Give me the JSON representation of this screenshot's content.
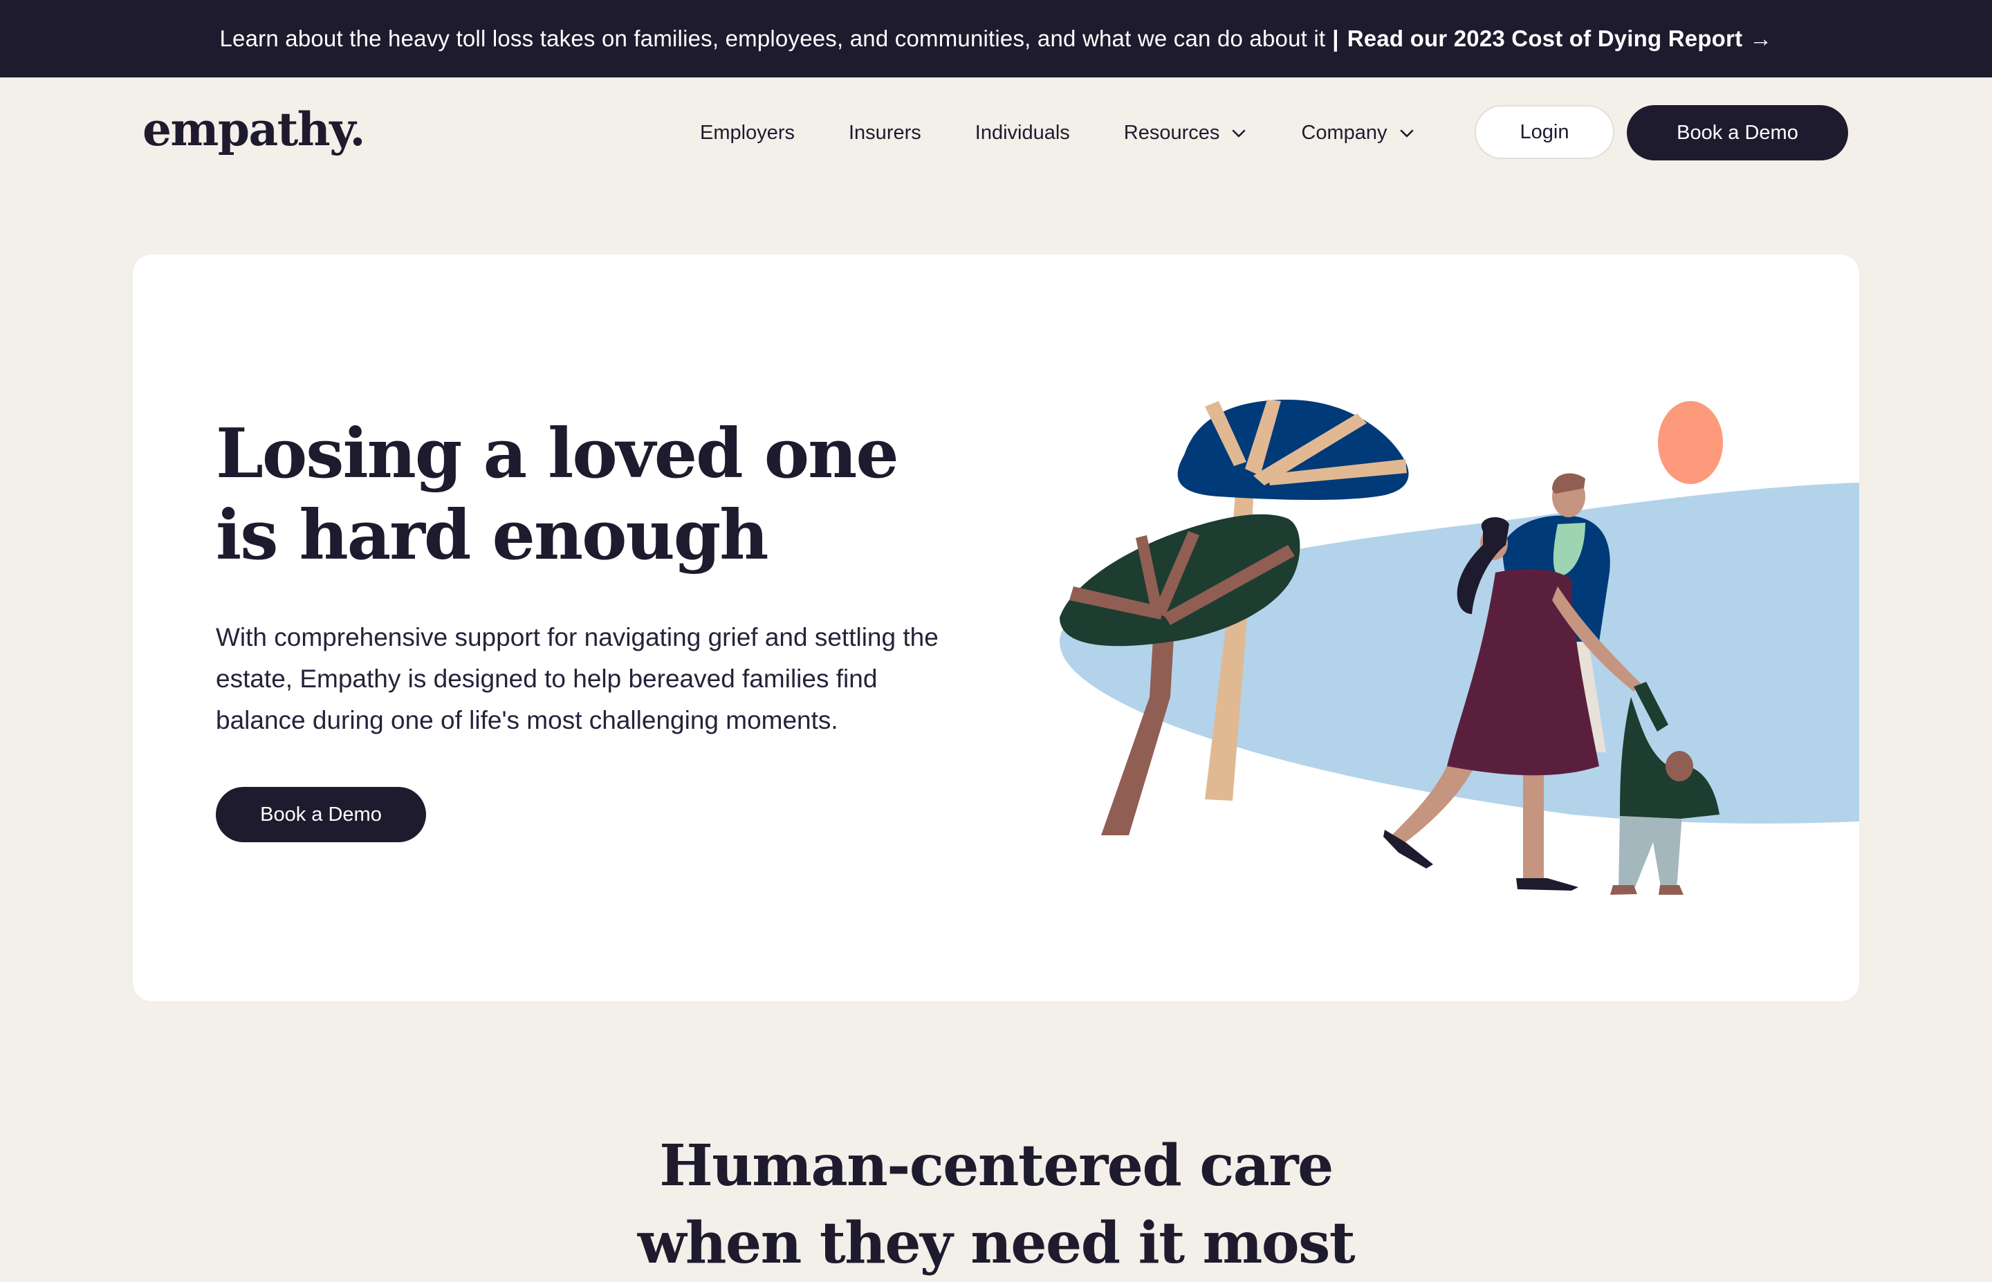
{
  "announcement": {
    "text": "Learn about the heavy toll loss takes on families, employees, and communities, and what we can do about it",
    "separator": "|",
    "cta": "Read our 2023 Cost of Dying Report",
    "arrow": "→"
  },
  "header": {
    "logo": "empathy.",
    "nav": [
      {
        "label": "Employers"
      },
      {
        "label": "Insurers"
      },
      {
        "label": "Individuals"
      },
      {
        "label": "Resources",
        "icon": "chevron-down-icon"
      },
      {
        "label": "Company",
        "icon": "chevron-down-icon"
      }
    ],
    "login": "Login",
    "book_demo": "Book a Demo"
  },
  "hero": {
    "title_line1": "Losing a loved one",
    "title_line2": "is hard enough",
    "subtitle": "With comprehensive support for navigating grief and settling the estate, Empathy is designed to help bereaved families find balance during one of life's most challenging moments.",
    "button": "Book a Demo",
    "illustration": "family-walking-illustration"
  },
  "section": {
    "title_line1": "Human-centered care",
    "title_line2": "when they need it most"
  },
  "colors": {
    "dark": "#1f1b2e",
    "background": "#f3efe9",
    "card": "#ffffff",
    "sky_blue": "#b3d3ea",
    "navy": "#003a78",
    "forest_green": "#1c3d2f",
    "plum": "#5b1f3e",
    "sun": "#fd9a7b"
  }
}
